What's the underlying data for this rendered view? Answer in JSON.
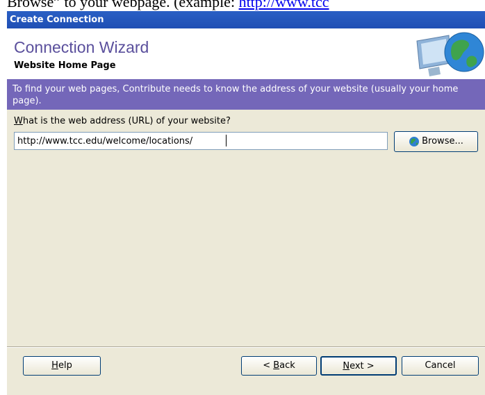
{
  "doc_strip": {
    "text": "Browse” to your webpage. (example: ",
    "link": "http://www.tcc"
  },
  "window": {
    "title": "Create Connection"
  },
  "header": {
    "title": "Connection Wizard",
    "subtitle": "Website Home Page"
  },
  "info": {
    "text": "To find your web pages, Contribute needs to know the address of your website (usually your home page)."
  },
  "form": {
    "label_accel": "W",
    "label_rest": "hat is the web address (URL) of your website?",
    "url_value": "http://www.tcc.edu/welcome/locations/"
  },
  "buttons": {
    "browse": "Browse...",
    "help_accel": "H",
    "help_rest": "elp",
    "back_prefix": "< ",
    "back_accel": "B",
    "back_rest": "ack",
    "next_accel": "N",
    "next_rest": "ext >",
    "cancel": "Cancel"
  },
  "colors": {
    "title_bar": "#2a5fc4",
    "header_title": "#5a4f9c",
    "info_band": "#7467b9",
    "dialog_bg": "#ece9d8"
  },
  "icons": [
    "globe-monitor-icon",
    "globe-icon"
  ]
}
